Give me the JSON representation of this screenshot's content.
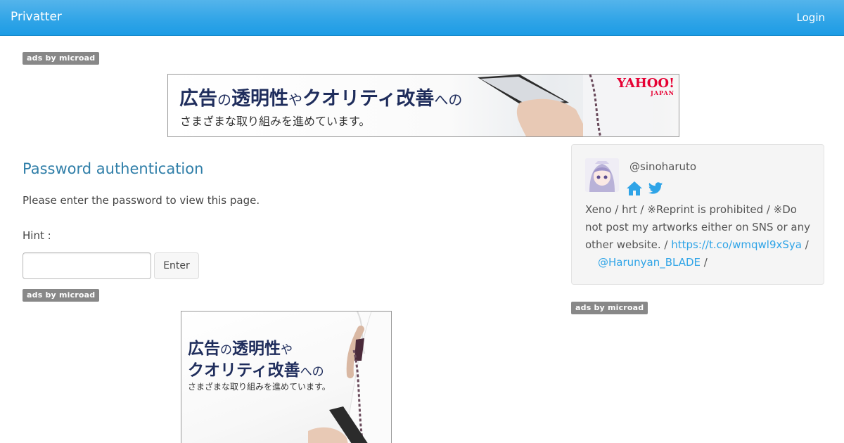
{
  "navbar": {
    "brand": "Privatter",
    "login": "Login"
  },
  "ads": {
    "badge": "ads by microad"
  },
  "banner_wide": {
    "headline_a": "広告",
    "headline_b": "の",
    "headline_c": "透明性",
    "headline_d": "や",
    "headline_e": "クオリティ改善",
    "headline_f": "への",
    "subline": "さまざまな取り組みを進めています。",
    "logo_main": "YAHOO!",
    "logo_sub": "JAPAN"
  },
  "main": {
    "title": "Password authentication",
    "description": "Please enter the password to view this page.",
    "hint_label": "Hint :",
    "password_value": "",
    "enter_label": "Enter"
  },
  "banner_square": {
    "l1a": "広告",
    "l1b": "の",
    "l1c": "透明性",
    "l1d": "や",
    "l2a": "クオリティ改善",
    "l2b": "への",
    "l3": "さまざまな取り組みを進めています。"
  },
  "profile": {
    "handle": "@sinoharuto",
    "icons": [
      "home-icon",
      "twitter-icon"
    ],
    "bio_text": "Xeno / hrt / ※Reprint is prohibited / ※Do not post my artworks either on SNS or any other website. /",
    "bio_link": "https://t.co/wmqwl9xSya",
    "bio_sep": "/",
    "bio_mention": "@Harunyan_BLADE",
    "bio_end": "/",
    "accent_color": "#2fa4e7"
  }
}
